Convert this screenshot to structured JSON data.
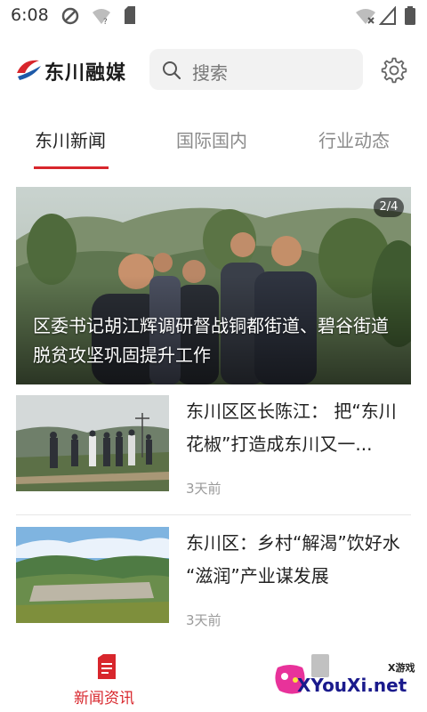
{
  "status_bar": {
    "time": "6:08"
  },
  "header": {
    "app_name": "东川融媒",
    "search_placeholder": "搜索"
  },
  "tabs": [
    {
      "label": "东川新闻",
      "active": true
    },
    {
      "label": "国际国内",
      "active": false
    },
    {
      "label": "行业动态",
      "active": false
    }
  ],
  "hero": {
    "counter": "2/4",
    "title": "区委书记胡江辉调研督战铜都街道、碧谷街道脱贫攻坚巩固提升工作"
  },
  "news": [
    {
      "title": "东川区区长陈江： 把“东川花椒”打造成东川又一...",
      "time": "3天前"
    },
    {
      "title": "东川区：乡村“解渴”饮好水 “滋润”产业谋发展",
      "time": "3天前"
    }
  ],
  "bottom_nav": {
    "label": "新闻资讯"
  },
  "watermark": {
    "sub": "X游戏",
    "text": "XYouXi.net"
  },
  "colors": {
    "accent": "#d8262c"
  }
}
